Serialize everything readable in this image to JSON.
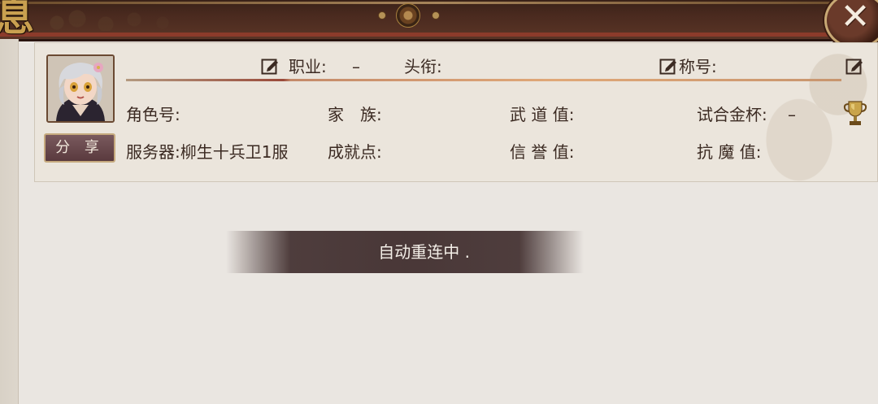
{
  "header": {
    "title_glyph": "息",
    "close_label": "✕"
  },
  "profile": {
    "share_label": "分 享",
    "job_label": "职业:",
    "job_value": "–",
    "rank_label": "头衔:",
    "title_label": "称号:",
    "role_id_label": "角色号:",
    "family_label": "家　族:",
    "wudao_label": "武 道 值:",
    "trial_cup_label": "试合金杯:",
    "trial_cup_value": "–",
    "server_label": "服务器:柳生十兵卫1服",
    "achievement_label": "成就点:",
    "credit_label": "信 誉 值:",
    "anti_magic_label": "抗 魔 值:"
  },
  "toast": {
    "message": "自动重连中 ."
  },
  "colors": {
    "header_bg": "#4a2a1f",
    "panel_bg": "#ebe5dc",
    "toast_bg": "#463434",
    "text": "#3b2a22"
  },
  "icons": [
    "edit-icon",
    "trophy-icon",
    "close-icon",
    "avatar"
  ]
}
